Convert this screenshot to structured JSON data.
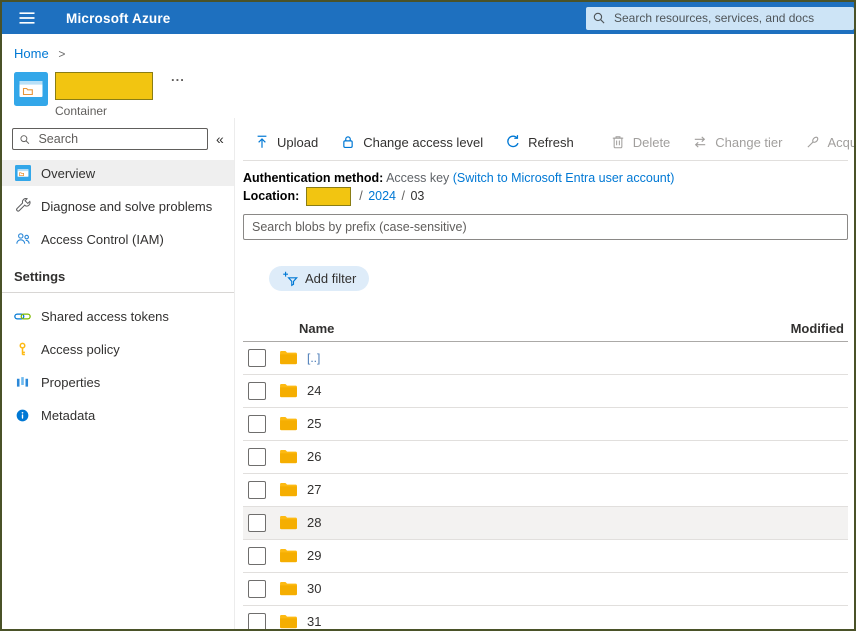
{
  "topbar": {
    "title": "Microsoft Azure",
    "search_placeholder": "Search resources, services, and docs"
  },
  "breadcrumb": {
    "home": "Home",
    "separator": ">"
  },
  "page_header": {
    "type_label": "Container",
    "more_label": "..."
  },
  "sidebar": {
    "search_placeholder": "Search",
    "collapse_glyph": "«",
    "items": [
      {
        "label": "Overview",
        "icon": "container-icon",
        "selected": true
      },
      {
        "label": "Diagnose and solve problems",
        "icon": "wrench-icon",
        "selected": false
      },
      {
        "label": "Access Control (IAM)",
        "icon": "people-icon",
        "selected": false
      }
    ],
    "settings_header": "Settings",
    "settings_items": [
      {
        "label": "Shared access tokens",
        "icon": "link-icon"
      },
      {
        "label": "Access policy",
        "icon": "key-icon"
      },
      {
        "label": "Properties",
        "icon": "columns-icon"
      },
      {
        "label": "Metadata",
        "icon": "info-icon"
      }
    ]
  },
  "toolbar": {
    "buttons": [
      {
        "label": "Upload",
        "icon": "upload-icon",
        "enabled": true
      },
      {
        "label": "Change access level",
        "icon": "lock-icon",
        "enabled": true
      },
      {
        "label": "Refresh",
        "icon": "refresh-icon",
        "enabled": true
      },
      {
        "label": "Delete",
        "icon": "trash-icon",
        "enabled": false
      },
      {
        "label": "Change tier",
        "icon": "change-tier-icon",
        "enabled": false
      },
      {
        "label": "Acquire lease",
        "icon": "lease-icon",
        "enabled": false
      }
    ]
  },
  "info": {
    "auth_label": "Authentication method:",
    "auth_value": "Access key",
    "auth_link": "(Switch to Microsoft Entra user account)",
    "location_label": "Location:",
    "separator": "/",
    "year": "2024",
    "month": "03"
  },
  "blob_search": {
    "placeholder": "Search blobs by prefix (case-sensitive)"
  },
  "filters": {
    "add_filter_label": "Add filter"
  },
  "table": {
    "columns": [
      "Name",
      "Modified"
    ],
    "rows": [
      {
        "name": "[..]",
        "type": "parent-folder"
      },
      {
        "name": "24",
        "type": "folder"
      },
      {
        "name": "25",
        "type": "folder"
      },
      {
        "name": "26",
        "type": "folder"
      },
      {
        "name": "27",
        "type": "folder"
      },
      {
        "name": "28",
        "type": "folder",
        "highlighted": true
      },
      {
        "name": "29",
        "type": "folder"
      },
      {
        "name": "30",
        "type": "folder"
      },
      {
        "name": "31",
        "type": "folder"
      }
    ]
  },
  "colors": {
    "topbar_bg": "#1e70bf",
    "accent_link": "#0078d4",
    "folder": "#fcb900",
    "redaction_fill": "#f2c511",
    "redaction_border": "#8a7d15",
    "frame_border": "#4a5228",
    "row_highlight": "#f3f2f1"
  }
}
